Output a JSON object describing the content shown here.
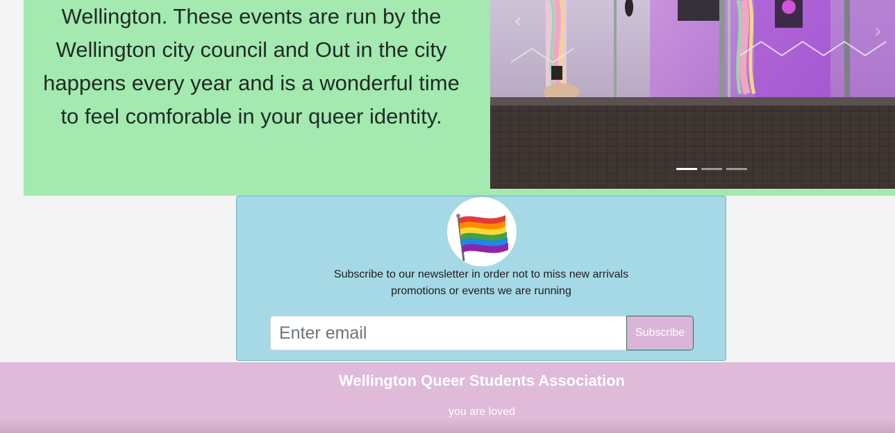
{
  "hero": {
    "text_lines": [
      "Wellington. These events are run by the",
      "Wellington city council and Out in the city",
      "happens every year and is a wonderful time",
      "to feel comforable in your queer identity."
    ],
    "background_color": "#a3e9b0"
  },
  "carousel": {
    "prev_icon": "chevron-left-icon",
    "next_icon": "chevron-right-icon",
    "prev_glyph": "‹",
    "next_glyph": "›",
    "indicator_count": 3,
    "active_index": 0
  },
  "newsletter": {
    "flag_icon": "rainbow-flag-icon",
    "text_line_1": "Subscribe to our newsletter in order not to miss new arrivals",
    "text_line_2": "promotions or events we are running",
    "email_placeholder": "Enter email",
    "subscribe_label": "Subscribe",
    "background_color": "#a5d9e6",
    "button_color": "#dbb5d9"
  },
  "footer": {
    "title": "Wellington Queer Students Association",
    "tagline": "you are loved",
    "background_color": "#dfbad9"
  }
}
